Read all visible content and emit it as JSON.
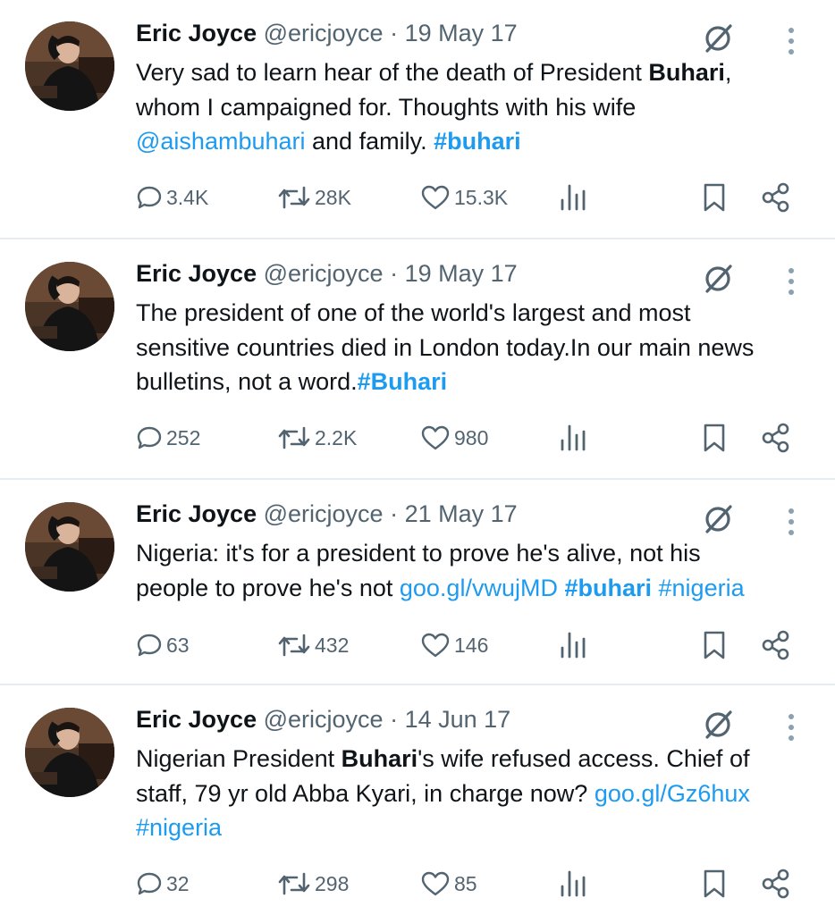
{
  "author": {
    "name": "Eric Joyce",
    "handle": "@ericjoyce"
  },
  "icons": [
    "grok-icon",
    "more-icon",
    "reply-icon",
    "retweet-icon",
    "like-icon",
    "views-icon",
    "bookmark-icon",
    "share-icon"
  ],
  "colors": {
    "link": "#1d9bf0",
    "muted": "#536471",
    "text": "#0f1419",
    "divider": "#e6ecf0"
  },
  "tweets": [
    {
      "date": "19 May 17",
      "segments": [
        {
          "t": "Very sad to learn hear of the death of President "
        },
        {
          "t": "Buhari",
          "s": "bold"
        },
        {
          "t": ",\nwhom I campaigned for. Thoughts with his wife\n"
        },
        {
          "t": "@aishambuhari",
          "s": "link"
        },
        {
          "t": " and family. "
        },
        {
          "t": "#buhari",
          "s": "linkbold"
        }
      ],
      "replies": "3.4K",
      "retweets": "28K",
      "likes": "15.3K"
    },
    {
      "date": "19 May 17",
      "segments": [
        {
          "t": "The president of one of the world's largest and most\nsensitive countries died in London today.In our main news\nbulletins, not a word."
        },
        {
          "t": "#Buhari",
          "s": "linkbold"
        }
      ],
      "replies": "252",
      "retweets": "2.2K",
      "likes": "980"
    },
    {
      "date": "21 May 17",
      "segments": [
        {
          "t": "Nigeria: it's for a president to prove he's alive, not his\npeople to prove he's not "
        },
        {
          "t": "goo.gl/vwujMD",
          "s": "link"
        },
        {
          "t": " "
        },
        {
          "t": "#buhari",
          "s": "linkbold"
        },
        {
          "t": " "
        },
        {
          "t": "#nigeria",
          "s": "link"
        }
      ],
      "replies": "63",
      "retweets": "432",
      "likes": "146"
    },
    {
      "date": "14 Jun 17",
      "segments": [
        {
          "t": "Nigerian President "
        },
        {
          "t": "Buhari",
          "s": "bold"
        },
        {
          "t": "'s wife refused access. Chief of\nstaff, 79 yr old Abba Kyari, in charge now? "
        },
        {
          "t": "goo.gl/Gz6hux",
          "s": "link"
        },
        {
          "t": "\n"
        },
        {
          "t": "#nigeria",
          "s": "link"
        }
      ],
      "replies": "32",
      "retweets": "298",
      "likes": "85"
    }
  ]
}
